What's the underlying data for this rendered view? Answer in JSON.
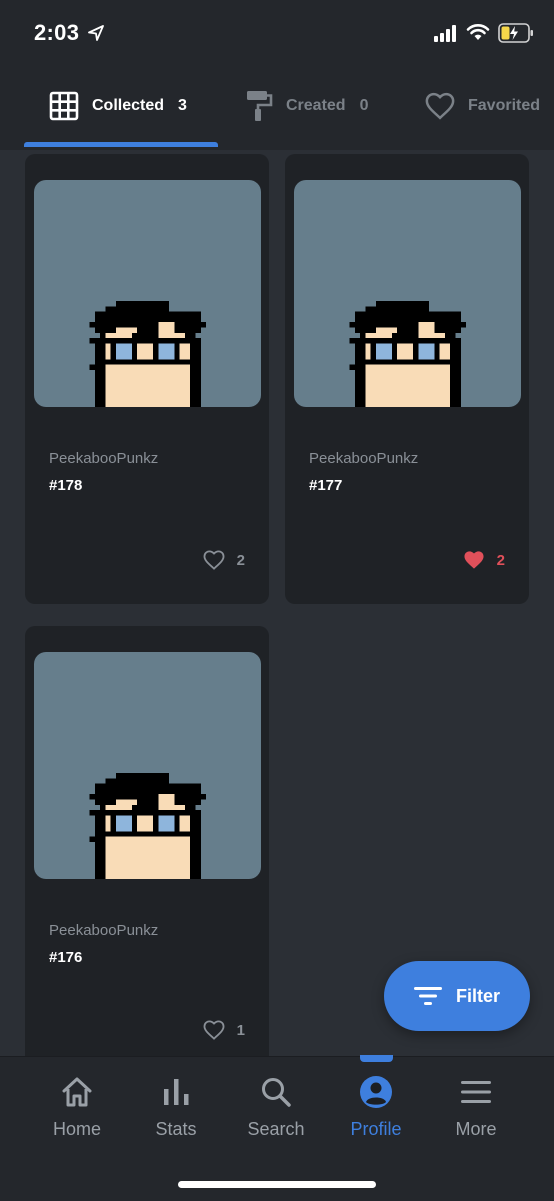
{
  "status_bar": {
    "time": "2:03",
    "icons": [
      "location-arrow-icon",
      "cellular-signal-icon",
      "wifi-icon",
      "battery-charging-icon"
    ]
  },
  "tabs": [
    {
      "label": "Collected",
      "count": "3",
      "icon": "grid-icon",
      "active": true
    },
    {
      "label": "Created",
      "count": "0",
      "icon": "paint-roller-icon",
      "active": false
    },
    {
      "label": "Favorited",
      "count": "",
      "icon": "heart-outline-icon",
      "active": false
    }
  ],
  "cards": [
    {
      "collection": "PeekabooPunkz",
      "token": "#178",
      "likes": "2",
      "liked": false
    },
    {
      "collection": "PeekabooPunkz",
      "token": "#177",
      "likes": "2",
      "liked": true
    },
    {
      "collection": "PeekabooPunkz",
      "token": "#176",
      "likes": "1",
      "liked": false
    }
  ],
  "filter_button": {
    "label": "Filter",
    "icon": "filter-icon"
  },
  "bottom_nav": [
    {
      "label": "Home",
      "icon": "home-icon",
      "active": false
    },
    {
      "label": "Stats",
      "icon": "bar-chart-icon",
      "active": false
    },
    {
      "label": "Search",
      "icon": "search-icon",
      "active": false
    },
    {
      "label": "Profile",
      "icon": "profile-icon",
      "active": true
    },
    {
      "label": "More",
      "icon": "menu-icon",
      "active": false
    }
  ],
  "colors": {
    "accent": "#3e7fde",
    "liked_heart": "#e0505a",
    "background": "#2b2f35",
    "card_background": "#1f2226",
    "image_background": "#667e8c"
  }
}
